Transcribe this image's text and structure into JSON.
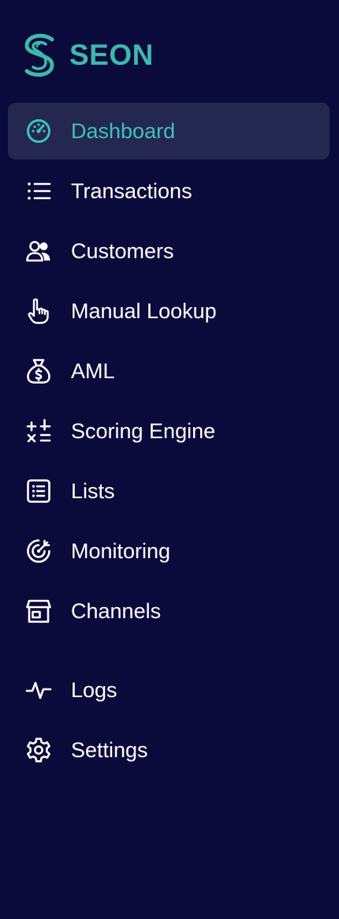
{
  "brand": {
    "name": "SEON",
    "accent_color": "#3fb7ad",
    "icon": "seon-logo-icon"
  },
  "theme": {
    "background": "#0a0b3b",
    "active_background": "#24274f",
    "active_text": "#3fc0c2",
    "text": "#ffffff"
  },
  "nav": {
    "items": [
      {
        "label": "Dashboard",
        "icon": "dashboard-gauge-icon",
        "active": true
      },
      {
        "label": "Transactions",
        "icon": "list-icon",
        "active": false
      },
      {
        "label": "Customers",
        "icon": "users-icon",
        "active": false
      },
      {
        "label": "Manual Lookup",
        "icon": "pointer-hand-icon",
        "active": false
      },
      {
        "label": "AML",
        "icon": "money-bag-icon",
        "active": false
      },
      {
        "label": "Scoring Engine",
        "icon": "calculator-operations-icon",
        "active": false
      },
      {
        "label": "Lists",
        "icon": "list-box-icon",
        "active": false
      },
      {
        "label": "Monitoring",
        "icon": "target-icon",
        "active": false
      },
      {
        "label": "Channels",
        "icon": "storefront-icon",
        "active": false
      }
    ],
    "secondary_items": [
      {
        "label": "Logs",
        "icon": "activity-pulse-icon",
        "active": false
      },
      {
        "label": "Settings",
        "icon": "gear-icon",
        "active": false
      }
    ]
  }
}
